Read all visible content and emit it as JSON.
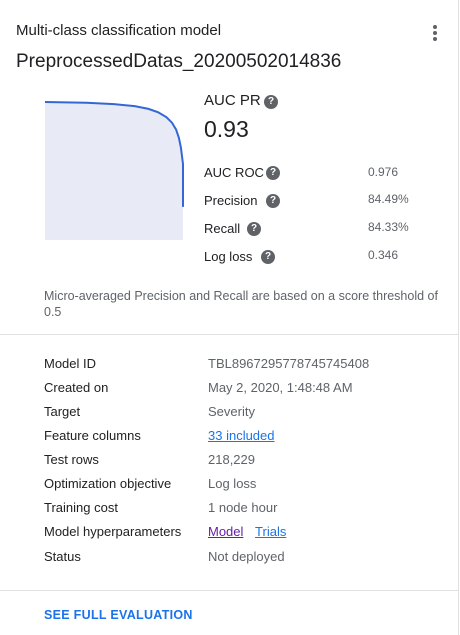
{
  "header": {
    "subtitle": "Multi-class classification model",
    "title": "PreprocessedDatas_20200502014836"
  },
  "chart_data": {
    "type": "line",
    "title": "",
    "xlabel": "",
    "ylabel": "",
    "xlim": [
      0,
      1
    ],
    "ylim": [
      0,
      1
    ],
    "grid": false,
    "series": [
      {
        "x": [
          0.0,
          0.3,
          0.5,
          0.65,
          0.75,
          0.82,
          0.88,
          0.92,
          0.95,
          0.97,
          0.985,
          1.0,
          1.0
        ],
        "y": [
          1.0,
          0.995,
          0.985,
          0.97,
          0.95,
          0.925,
          0.89,
          0.85,
          0.8,
          0.74,
          0.67,
          0.55,
          0.24
        ]
      }
    ],
    "colors": {
      "line": "#3367d6",
      "fill": "#e8eaf6"
    }
  },
  "metrics": {
    "auc_pr_label": "AUC PR",
    "auc_pr_value": "0.93",
    "items": [
      {
        "label": "AUC ROC",
        "value": "0.976"
      },
      {
        "label": "Precision",
        "value": "84.49%"
      },
      {
        "label": "Recall",
        "value": "84.33%"
      },
      {
        "label": "Log loss",
        "value": "0.346"
      }
    ],
    "help_glyph": "?"
  },
  "note": "Micro-averaged Precision and Recall are based on a score threshold of 0.5",
  "details": {
    "model_id_label": "Model ID",
    "model_id": "TBL8967295778745745408",
    "created_label": "Created on",
    "created": "May 2, 2020, 1:48:48 AM",
    "target_label": "Target",
    "target": "Severity",
    "features_label": "Feature columns",
    "features": "33 included",
    "test_rows_label": "Test rows",
    "test_rows": "218,229",
    "objective_label": "Optimization objective",
    "objective": "Log loss",
    "cost_label": "Training cost",
    "cost": "1 node hour",
    "hyper_label": "Model hyperparameters",
    "hyper_model": "Model",
    "hyper_trials": "Trials",
    "status_label": "Status",
    "status": "Not deployed"
  },
  "footer": {
    "cta": "SEE FULL EVALUATION"
  },
  "icons": {
    "menu": "more-vert-icon",
    "help": "help-icon"
  }
}
